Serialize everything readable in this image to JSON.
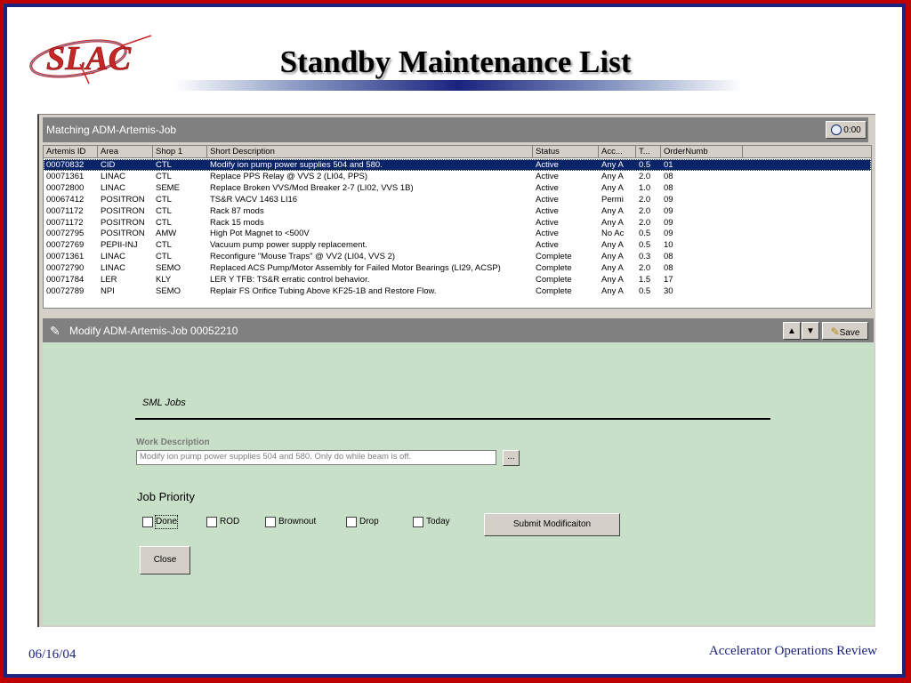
{
  "slide": {
    "title": "Standby Maintenance List",
    "date": "06/16/04",
    "footer": "Accelerator Operations Review",
    "logo_text": "SLAC"
  },
  "list_panel": {
    "title": "Matching ADM-Artemis-Job",
    "timer": "0:00",
    "columns": [
      "Artemis ID",
      "Area",
      "Shop 1",
      "Short Description",
      "Status",
      "Acc...",
      "T...",
      "OrderNumb"
    ],
    "rows": [
      {
        "id": "00070832",
        "area": "CID",
        "shop": "CTL",
        "desc": "Modify ion pump power supplies 504 and 580.",
        "status": "Active",
        "acc": "Any A",
        "t": "0.5",
        "order": "01"
      },
      {
        "id": "00071361",
        "area": "LINAC",
        "shop": "CTL",
        "desc": "Replace PPS Relay @ VVS 2 (LI04, PPS)",
        "status": "Active",
        "acc": "Any A",
        "t": "2.0",
        "order": "08"
      },
      {
        "id": "00072800",
        "area": "LINAC",
        "shop": "SEME",
        "desc": "Replace Broken VVS/Mod Breaker 2-7 (LI02, VVS 1B)",
        "status": "Active",
        "acc": "Any A",
        "t": "1.0",
        "order": "08"
      },
      {
        "id": "00067412",
        "area": "POSITRON",
        "shop": "CTL",
        "desc": "TS&R VACV 1463 LI16",
        "status": "Active",
        "acc": "Permi",
        "t": "2.0",
        "order": "09"
      },
      {
        "id": "00071172",
        "area": "POSITRON",
        "shop": "CTL",
        "desc": "Rack 87 mods",
        "status": "Active",
        "acc": "Any A",
        "t": "2.0",
        "order": "09"
      },
      {
        "id": "00071172",
        "area": "POSITRON",
        "shop": "CTL",
        "desc": "Rack 15 mods",
        "status": "Active",
        "acc": "Any A",
        "t": "2.0",
        "order": "09"
      },
      {
        "id": "00072795",
        "area": "POSITRON",
        "shop": "AMW",
        "desc": "High Pot Magnet to <500V",
        "status": "Active",
        "acc": "No Ac",
        "t": "0.5",
        "order": "09"
      },
      {
        "id": "00072769",
        "area": "PEPII-INJ",
        "shop": "CTL",
        "desc": "Vacuum pump power supply replacement.",
        "status": "Active",
        "acc": "Any A",
        "t": "0.5",
        "order": "10"
      },
      {
        "id": "00071361",
        "area": "LINAC",
        "shop": "CTL",
        "desc": "Reconfigure \"Mouse Traps\" @ VV2 (LI04, VVS 2)",
        "status": "Complete",
        "acc": "Any A",
        "t": "0.3",
        "order": "08"
      },
      {
        "id": "00072790",
        "area": "LINAC",
        "shop": "SEMO",
        "desc": "Replaced ACS Pump/Motor Assembly for Failed Motor Bearings (LI29, ACSP)",
        "status": "Complete",
        "acc": "Any A",
        "t": "2.0",
        "order": "08"
      },
      {
        "id": "00071784",
        "area": "LER",
        "shop": "KLY",
        "desc": "LER Y TFB: TS&R erratic control behavior.",
        "status": "Complete",
        "acc": "Any A",
        "t": "1.5",
        "order": "17"
      },
      {
        "id": "00072789",
        "area": "NPI",
        "shop": "SEMO",
        "desc": "Replair FS Orifice Tubing Above KF25-1B and Restore Flow.",
        "status": "Complete",
        "acc": "Any A",
        "t": "0.5",
        "order": "30"
      }
    ]
  },
  "modify_panel": {
    "title": "Modify ADM-Artemis-Job 00052210",
    "save_label": "Save",
    "section_title": "SML Jobs",
    "work_desc_label": "Work Description",
    "work_desc_value": "Modify ion pump power supplies 504 and 580.  Only do while beam is off.",
    "browse_label": "...",
    "job_priority_label": "Job Priority",
    "checkboxes": [
      {
        "label": "Done",
        "checked": false
      },
      {
        "label": "ROD",
        "checked": false
      },
      {
        "label": "Brownout",
        "checked": false
      },
      {
        "label": "Drop",
        "checked": false
      },
      {
        "label": "Today",
        "checked": false
      }
    ],
    "submit_label": "Submit Modificaiton",
    "close_label": "Close"
  },
  "colors": {
    "outer_border": "#c00000",
    "inner_border": "#1a237e",
    "selection": "#0a246a",
    "form_background": "#c8dfc8",
    "panel_header": "#808080"
  }
}
